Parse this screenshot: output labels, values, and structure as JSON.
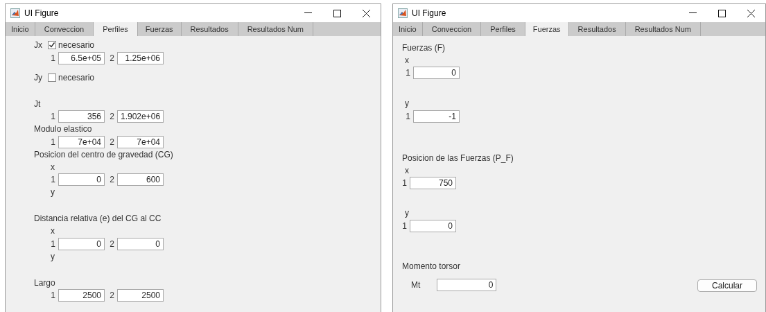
{
  "windows": [
    {
      "title": "UI Figure",
      "tabs": [
        {
          "label": "Inicio",
          "selected": false
        },
        {
          "label": "Conveccion",
          "selected": false
        },
        {
          "label": "Perfiles",
          "selected": true
        },
        {
          "label": "Fuerzas",
          "selected": false
        },
        {
          "label": "Resultados",
          "selected": false
        },
        {
          "label": "Resultados Num",
          "selected": false
        }
      ],
      "items": [
        {
          "kind": "check",
          "label": "Jx",
          "text": "necesario",
          "checked": true
        },
        {
          "kind": "pair",
          "values": [
            {
              "index": "1",
              "value": "6.5e+05"
            },
            {
              "index": "2",
              "value": "1.25e+06"
            }
          ]
        },
        {
          "kind": "check",
          "label": "Jy",
          "text": "necesario",
          "checked": false
        },
        {
          "kind": "heading",
          "text": "Jt"
        },
        {
          "kind": "pair",
          "values": [
            {
              "index": "1",
              "value": "356"
            },
            {
              "index": "2",
              "value": "1.902e+06"
            }
          ]
        },
        {
          "kind": "heading",
          "text": "Modulo elastico"
        },
        {
          "kind": "pair",
          "values": [
            {
              "index": "1",
              "value": "7e+04"
            },
            {
              "index": "2",
              "value": "7e+04"
            }
          ]
        },
        {
          "kind": "heading",
          "text": "Posicion del centro de gravedad (CG)"
        },
        {
          "kind": "axis",
          "text": "x"
        },
        {
          "kind": "pair",
          "values": [
            {
              "index": "1",
              "value": "0"
            },
            {
              "index": "2",
              "value": "600"
            }
          ]
        },
        {
          "kind": "axis",
          "text": "y"
        },
        {
          "kind": "heading",
          "text": "Distancia relativa (e) del CG al CC"
        },
        {
          "kind": "axis",
          "text": "x"
        },
        {
          "kind": "pair",
          "values": [
            {
              "index": "1",
              "value": "0"
            },
            {
              "index": "2",
              "value": "0"
            }
          ]
        },
        {
          "kind": "axis",
          "text": "y"
        },
        {
          "kind": "heading",
          "text": "Largo"
        },
        {
          "kind": "pair",
          "values": [
            {
              "index": "1",
              "value": "2500"
            },
            {
              "index": "2",
              "value": "2500"
            }
          ]
        }
      ]
    },
    {
      "title": "UI Figure",
      "tabs": [
        {
          "label": "Inicio",
          "selected": false
        },
        {
          "label": "Conveccion",
          "selected": false
        },
        {
          "label": "Perfiles",
          "selected": false
        },
        {
          "label": "Fuerzas",
          "selected": true
        },
        {
          "label": "Resultados",
          "selected": false
        },
        {
          "label": "Resultados Num",
          "selected": false
        }
      ],
      "items": [
        {
          "kind": "heading",
          "text": "Fuerzas (F)"
        },
        {
          "kind": "axis",
          "text": "x"
        },
        {
          "kind": "pair",
          "values": [
            {
              "index": "1",
              "value": "0"
            }
          ]
        },
        {
          "kind": "axis",
          "text": "y"
        },
        {
          "kind": "pair",
          "values": [
            {
              "index": "1",
              "value": "-1"
            }
          ]
        },
        {
          "kind": "heading",
          "text": "Posicion de las Fuerzas (P_F)"
        },
        {
          "kind": "axis",
          "text": "x"
        },
        {
          "kind": "pair",
          "values": [
            {
              "index": "1",
              "value": "750"
            }
          ]
        },
        {
          "kind": "axis",
          "text": "y"
        },
        {
          "kind": "pair",
          "values": [
            {
              "index": "1",
              "value": "0"
            }
          ]
        },
        {
          "kind": "heading",
          "text": "Momento torsor"
        },
        {
          "kind": "labeled",
          "label": "Mt",
          "value": "0",
          "button": "Calcular"
        }
      ]
    }
  ]
}
